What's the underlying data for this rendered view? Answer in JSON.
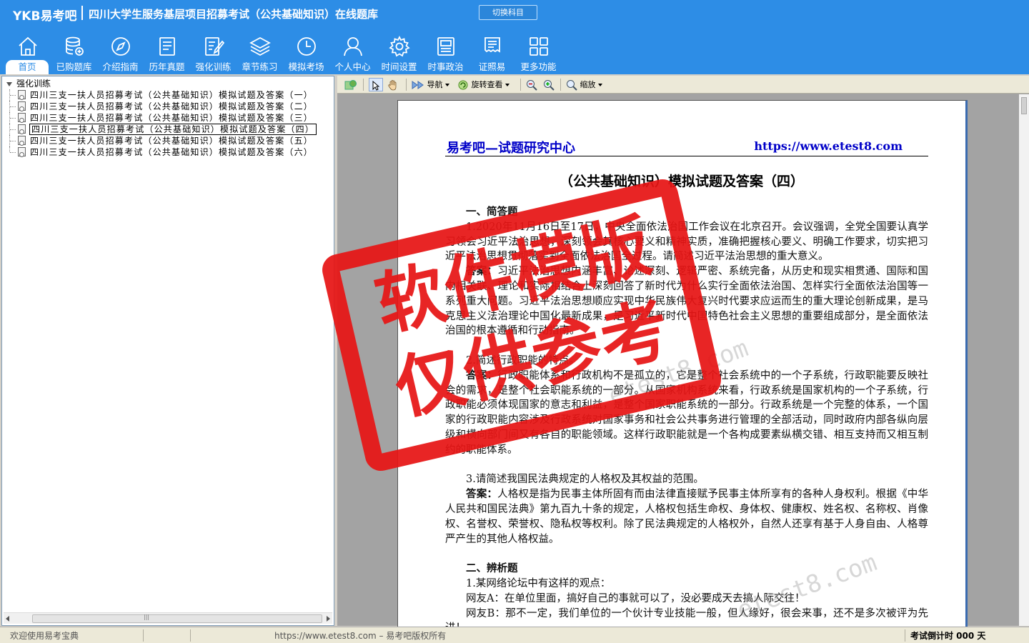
{
  "header": {
    "brand": "YKB易考吧",
    "title": "四川大学生服务基层项目招募考试（公共基础知识）在线题库",
    "switch_label": "切换科目"
  },
  "nav": [
    {
      "label": "首页",
      "icon": "home-icon"
    },
    {
      "label": "已购题库",
      "icon": "database-icon"
    },
    {
      "label": "介绍指南",
      "icon": "compass-icon"
    },
    {
      "label": "历年真题",
      "icon": "document-list-icon"
    },
    {
      "label": "强化训练",
      "icon": "edit-document-icon"
    },
    {
      "label": "章节练习",
      "icon": "layers-icon"
    },
    {
      "label": "模拟考场",
      "icon": "clock-icon"
    },
    {
      "label": "个人中心",
      "icon": "user-icon"
    },
    {
      "label": "时间设置",
      "icon": "gear-icon"
    },
    {
      "label": "时事政治",
      "icon": "newspaper-icon"
    },
    {
      "label": "证照易",
      "icon": "certificate-icon"
    },
    {
      "label": "更多功能",
      "icon": "grid-icon"
    }
  ],
  "tree": {
    "root": "强化训练",
    "items": [
      "四川三支一扶人员招募考试（公共基础知识）模拟试题及答案（一）",
      "四川三支一扶人员招募考试（公共基础知识）模拟试题及答案（二）",
      "四川三支一扶人员招募考试（公共基础知识）模拟试题及答案（三）",
      "四川三支一扶人员招募考试（公共基础知识）模拟试题及答案（四）",
      "四川三支一扶人员招募考试（公共基础知识）模拟试题及答案（五）",
      "四川三支一扶人员招募考试（公共基础知识）模拟试题及答案（六）"
    ],
    "selected_index": 3
  },
  "toolbar": {
    "nav_label": "导航",
    "rotate_label": "旋转查看",
    "zoom_label": "缩放"
  },
  "document": {
    "brand": "易考吧—试题研究中心",
    "url": "https://www.etest8.com",
    "title": "（公共基础知识）模拟试题及答案（四）",
    "sec1": "一、简答题",
    "q1": "1.2020年11月16日至17日，中央全面依法治国工作会议在北京召开。会议强调，全党全国要认真学习领会习近平法治思想，深刻领会其核心要义和精神实质，准确把握核心要义、明确工作要求，切实把习近平法治思想贯彻落实到全面依法治国全过程。请简述习近平法治思想的重大意义。",
    "a1_label": "答案：",
    "a1": "习近平法治思想内涵丰富、论述深刻、逻辑严密、系统完备，从历史和现实相贯通、国际和国内相关联、理论和实际相结合上深刻回答了新时代为什么实行全面依法治国、怎样实行全面依法治国等一系列重大问题。习近平法治思想顺应实现中华民族伟大复兴时代要求应运而生的重大理论创新成果，是马克思主义法治理论中国化最新成果，是习近平新时代中国特色社会主义思想的重要组成部分，是全面依法治国的根本遵循和行动指南。",
    "q2": "2.简述行政职能的特点。",
    "a2_label": "答案：",
    "a2": "行政职能体系和行政机构不是孤立的，它是整个社会系统中的一个子系统，行政职能要反映社会的需求，是整个社会职能系统的一部分。从国家机构系统来看，行政系统是国家机构的一个子系统，行政职能必须体现国家的意志和利益，是整个国家职能系统的一部分。行政系统是一个完整的体系，一个国家的行政职能内容涉及行政系统对国家事务和社会公共事务进行管理的全部活动，同时政府内部各纵向层级和横向部门间又有各自的职能领域。这样行政职能就是一个各构成要素纵横交错、相互支持而又相互制约的职能体系。",
    "q3": "3.请简述我国民法典规定的人格权及其权益的范围。",
    "a3_label": "答案：",
    "a3": "人格权是指为民事主体所固有而由法律直接赋予民事主体所享有的各种人身权利。根据《中华人民共和国民法典》第九百九十条的规定，人格权包括生命权、身体权、健康权、姓名权、名称权、肖像权、名誉权、荣誉权、隐私权等权利。除了民法典规定的人格权外，自然人还享有基于人身自由、人格尊严产生的其他人格权益。",
    "sec2": "二、辨析题",
    "q4": "1.某网络论坛中有这样的观点：",
    "netizen_a": "网友A：在单位里面，搞好自己的事就可以了，没必要成天去搞人际交往！",
    "netizen_b": "网友B：那不一定，我们单位的一个伙计专业技能一般，但人缘好，很会来事，还不是多次被评为先进！",
    "watermark": "etest8.com"
  },
  "stamp": {
    "line1": "软件模版",
    "line2": "仅供参考"
  },
  "status": {
    "welcome": "欢迎使用易考宝典",
    "copyright": "https://www.etest8.com – 易考吧版权所有",
    "countdown": "考试倒计时 000 天"
  }
}
